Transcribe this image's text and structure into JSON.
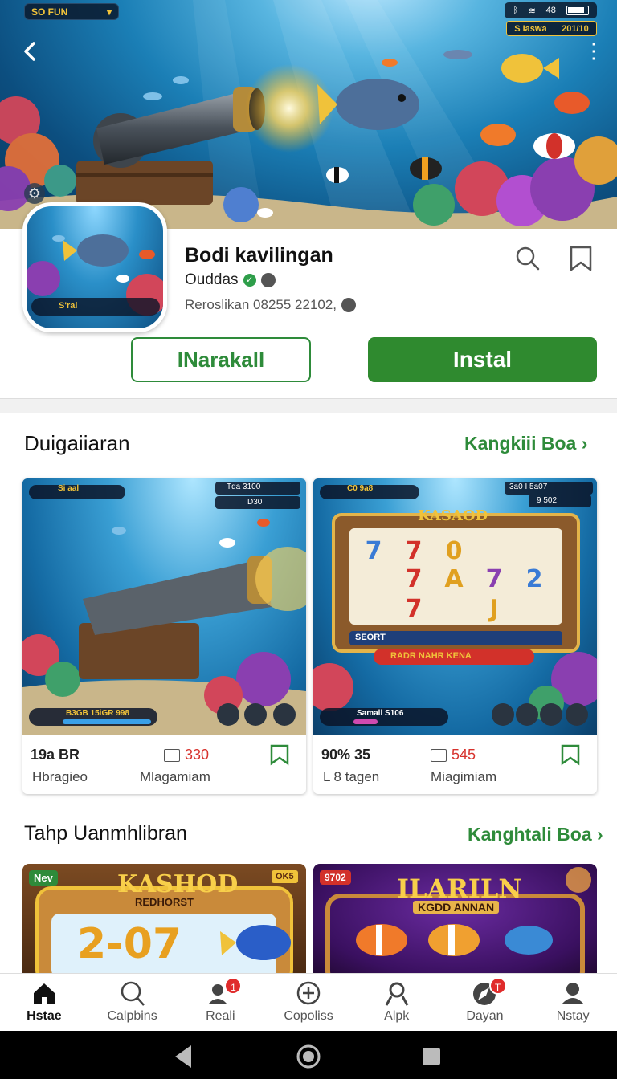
{
  "status": {
    "game_label": "SO FUN",
    "score_label": "S Iaswa",
    "score_value": "201/10",
    "sys_text": "48"
  },
  "app": {
    "title": "Bodi kavilingan",
    "developer": "Ouddas",
    "meta": "Reroslikan 08255 22102,",
    "icon_bar_label": "S'rai",
    "secondary_button": "INarakall",
    "install_button": "Instal"
  },
  "section1": {
    "title": "Duigaiiaran",
    "link": "Kangkiii Boa",
    "cards": [
      {
        "title": "19a BR",
        "subtitle": "Hbragieo",
        "count": "330",
        "count_label": "Mlagamiam",
        "hud_top": "Si aal",
        "hud_a": "Tda 3100",
        "hud_b": "D30",
        "hud_bottom": "B3GB 15iGR 998"
      },
      {
        "title": "90% 35",
        "subtitle": "L 8 tagen",
        "count": "545",
        "count_label": "Miagimiam",
        "hud_top": "C0 9a8",
        "hud_a": "3a0 I 5a07",
        "hud_b": "9 502",
        "hud_bottom": "Samall S106",
        "slot_title": "KASAOD",
        "slot_banner": "RADR NAHR KENA",
        "slot_left": "SEORT"
      }
    ]
  },
  "section2": {
    "title": "Tahp Uanmhlibran",
    "link": "Kanghtali Boa",
    "cards": [
      {
        "badge": "Nev",
        "corner": "OK5",
        "title": "KASHOD",
        "subtitle": "REDHORST",
        "digits": "2-07"
      },
      {
        "badge": "9702",
        "title": "ILARILN",
        "subtitle": "KGDD ANNAN"
      }
    ]
  },
  "nav": {
    "items": [
      {
        "label": "Hstae",
        "icon": "home-icon",
        "active": true
      },
      {
        "label": "Calpbins",
        "icon": "search-icon"
      },
      {
        "label": "Reali",
        "icon": "people-icon",
        "badge": "1"
      },
      {
        "label": "Copoliss",
        "icon": "plus-circle-icon"
      },
      {
        "label": "Alpk",
        "icon": "person-icon"
      },
      {
        "label": "Dayan",
        "icon": "compass-icon",
        "badge": "T"
      },
      {
        "label": "Nstay",
        "icon": "account-icon"
      }
    ]
  },
  "colors": {
    "brand_green": "#2f8a2f",
    "link_green": "#2e8b3a",
    "badge_red": "#e02b2b",
    "count_red": "#d7322d"
  }
}
